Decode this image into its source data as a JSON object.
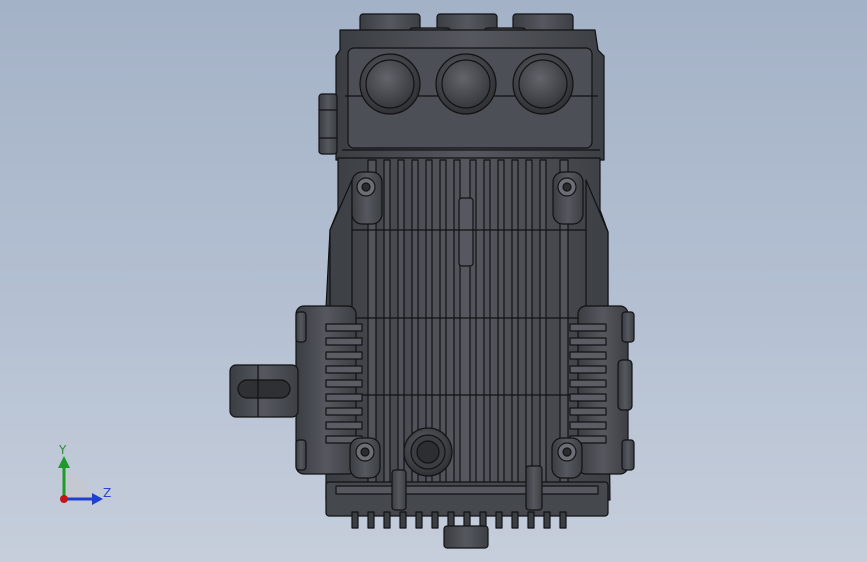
{
  "viewport": {
    "background_top": "#a4b2c7",
    "background_bottom": "#c6cedb"
  },
  "model": {
    "body_color": "#4a4d52",
    "edge_color": "#101113"
  },
  "triad": {
    "y_label": "Y",
    "z_label": "Z",
    "y_color": "#1f9a2a",
    "z_color": "#1f3fd0",
    "x_color": "#c01818"
  }
}
